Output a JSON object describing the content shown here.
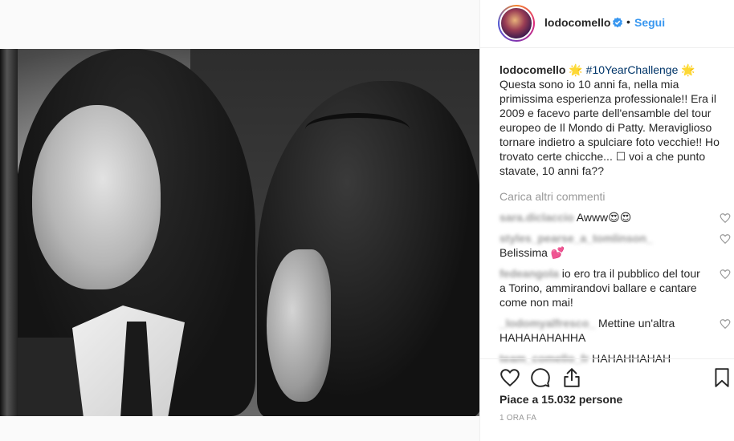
{
  "post": {
    "author": "lodocomello",
    "follow_label": "Segui",
    "separator": "•",
    "caption": {
      "user": "lodocomello",
      "star": "🌟",
      "hashtag": "#10YearChallenge",
      "text": "Questa sono io 10 anni fa, nella mia primissima esperienza professionale!! Era il 2009 e facevo parte dell'ensamble del tour europeo de Il Mondo di Patty. Meraviglioso tornare indietro a spulciare foto vecchie!! Ho trovato certe chicche... ☐ voi a che punto stavate, 10 anni fa??"
    },
    "load_more_label": "Carica altri commenti",
    "comments": [
      {
        "user": "sara.diclaccio",
        "text": "Awww😍😍"
      },
      {
        "user": "styles_pearse_a_tomlinson_",
        "text": "Belissima 💕"
      },
      {
        "user": "fedeangola",
        "text": "io ero tra il pubblico del tour a Torino, ammirandovi ballare e cantare come non mai!"
      },
      {
        "user": "_lodomyalfresco_",
        "text": "Mettine un'altra HAHAHAHAHHA"
      },
      {
        "user": "team_comello_fr",
        "text": "HAHAHHAHAH"
      }
    ],
    "likes_text": "Piace a 15.032 persone",
    "timestamp": "1 ORA FA"
  },
  "icons": {
    "verified": "verified-badge-icon",
    "like": "heart-icon",
    "comment": "comment-bubble-icon",
    "share": "share-icon",
    "save": "bookmark-icon"
  },
  "colors": {
    "link_blue": "#3897f0",
    "hashtag": "#003569",
    "muted": "#999999",
    "text": "#262626"
  }
}
